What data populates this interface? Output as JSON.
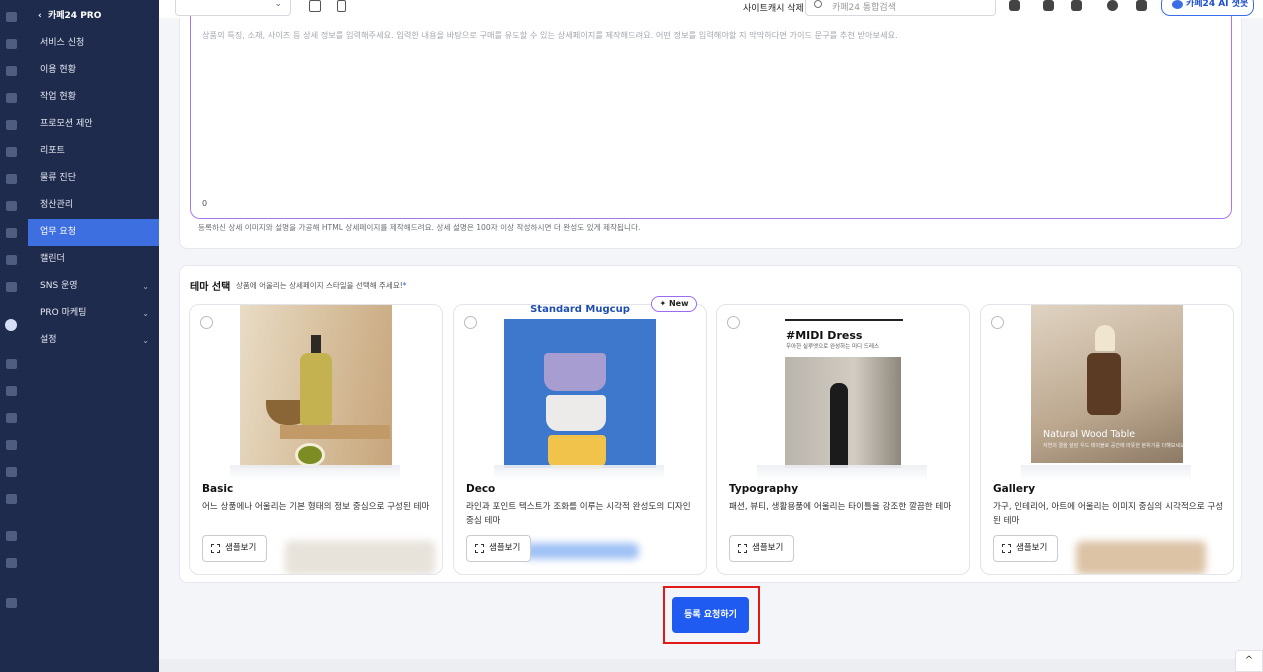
{
  "sidebar": {
    "back_label": "카페24 PRO",
    "items": [
      {
        "label": "서비스 신청"
      },
      {
        "label": "이용 현황"
      },
      {
        "label": "작업 현황"
      },
      {
        "label": "프로모션 제안"
      },
      {
        "label": "리포트"
      },
      {
        "label": "물류 진단"
      },
      {
        "label": "정산관리"
      },
      {
        "label": "업무 요청"
      },
      {
        "label": "캘린더"
      },
      {
        "label": "SNS 운영",
        "chevron": "⌄"
      },
      {
        "label": "PRO 마케팅",
        "chevron": "⌄"
      },
      {
        "label": "설정",
        "chevron": "⌄"
      }
    ],
    "active_index": 7
  },
  "topbar": {
    "select_caret": "⌄",
    "clear_cache_label": "사이트캐시 삭제",
    "search_placeholder": "카페24 통합검색",
    "ai_chat_label": "카페24 AI 챗봇"
  },
  "description": {
    "placeholder": "상품의 특징, 소재, 사이즈 등 상세 정보를 입력해주세요. 입력한 내용을 바탕으로 구매를 유도할 수 있는 상세페이지를 제작해드려요. 어떤 정보를 입력해야할 지 막막하다면 가이드 문구를 추천 받아보세요.",
    "char_count": "0",
    "help_text": "등록하신 상세 이미지와 설명을 가공해 HTML 상세페이지를 제작해드려요. 상세 설명은 100자 이상 작성하시면 더 완성도 있게 제작됩니다."
  },
  "theme_section": {
    "title": "테마 선택",
    "subtitle": "상품에 어울리는 상세페이지 스타일을 선택해 주세요!",
    "required_mark": "*",
    "sample_label": "샘플보기",
    "themes": [
      {
        "name": "Basic",
        "description": "어느 상품에나 어울리는 기본 형태의 정보 중심으로 구성된 테마"
      },
      {
        "name": "Deco",
        "description": "라인과 포인트 텍스트가 조화를 이루는 시각적 완성도의 디자인 중심 테마",
        "badge": "New",
        "thumb_title": "Standard Mugcup"
      },
      {
        "name": "Typography",
        "description": "패션, 뷰티, 생활용품에 어울리는 타이틀을 강조한 깔끔한 테마",
        "thumb_title": "#MIDI Dress",
        "thumb_subtitle": "우아한 실루엣으로 완성하는 미디 드레스"
      },
      {
        "name": "Gallery",
        "description": "가구, 인테리어, 아트에 어울리는 이미지 중심의 시각적으로 구성된 테마",
        "thumb_title": "Natural Wood Table",
        "thumb_subtitle": "자연의 결을 살린 우드 테이블로 공간에 따뜻한 분위기를 더해보세요"
      }
    ]
  },
  "submit_label": "등록 요청하기",
  "scroll_top_glyph": "^",
  "colors": {
    "sidebar_bg": "#1f2b4d",
    "active_nav": "#3e6fe0",
    "primary_button": "#1f5bf0",
    "highlight_frame": "#e01919",
    "textarea_border": "#a878f0"
  }
}
